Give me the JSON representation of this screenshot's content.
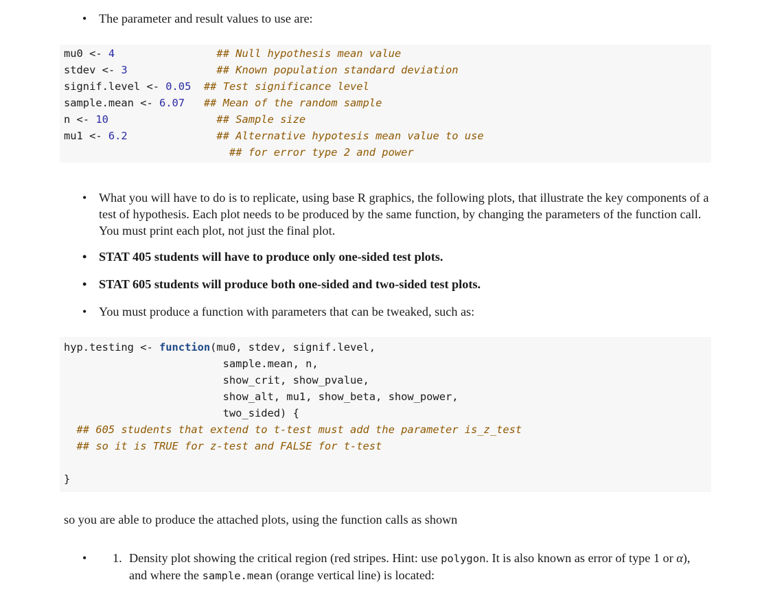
{
  "intro_bullet": "The parameter and result values to use are:",
  "params_code": [
    {
      "lhs": "mu0 <- ",
      "value": "4",
      "pad": "                ",
      "comment": "## Null hypothesis mean value"
    },
    {
      "lhs": "stdev <- ",
      "value": "3",
      "pad": "              ",
      "comment": "## Known population standard deviation"
    },
    {
      "lhs": "signif.level <- ",
      "value": "0.05",
      "pad": "  ",
      "comment": "## Test significance level"
    },
    {
      "lhs": "sample.mean <- ",
      "value": "6.07",
      "pad": "   ",
      "comment": "## Mean of the random sample"
    },
    {
      "lhs": "n <- ",
      "value": "10",
      "pad": "                 ",
      "comment": "## Sample size"
    },
    {
      "lhs": "mu1 <- ",
      "value": "6.2",
      "pad": "              ",
      "comment": "## Alternative hypotesis mean value to use"
    },
    {
      "lhs": "",
      "value": "",
      "pad": "                          ",
      "comment": "## for error type 2 and power"
    }
  ],
  "bullets": [
    {
      "text": "What you will have to do is to replicate, using base R graphics, the following plots, that illustrate the key components of a test of hypothesis. Each plot needs to be produced by the same function, by changing the parameters of the function call. You must print each plot, not just the final plot.",
      "bold": false
    },
    {
      "text": "STAT 405 students will have to produce only one-sided test plots.",
      "bold": true
    },
    {
      "text": "STAT 605 students will produce both one-sided and two-sided test plots.",
      "bold": true
    },
    {
      "text": "You must produce a function with parameters that can be tweaked, such as:",
      "bold": false
    }
  ],
  "function_code": {
    "name": "hyp.testing <- ",
    "keyword": "function",
    "lines": [
      "(mu0, stdev, signif.level,",
      "                         sample.mean, n,",
      "                         show_crit, show_pvalue,",
      "                         show_alt, mu1, show_beta, show_power,",
      "                         two_sided) {"
    ],
    "comments": [
      "  ## 605 students that extend to t-test must add the parameter is_z_test",
      "  ## so it is TRUE for z-test and FALSE for t-test"
    ],
    "closing": "}"
  },
  "closing_paragraph": "so you are able to produce the attached plots, using the function calls as shown",
  "numbered_item": {
    "number": "1.",
    "part1": "Density plot showing the critical region (red stripes. Hint: use ",
    "code1": "polygon",
    "part2": ". It is also known as error of type 1 or ",
    "alpha": "α",
    "part3": "), and where the ",
    "code2": "sample.mean",
    "part4": " (orange vertical line) is located:"
  }
}
